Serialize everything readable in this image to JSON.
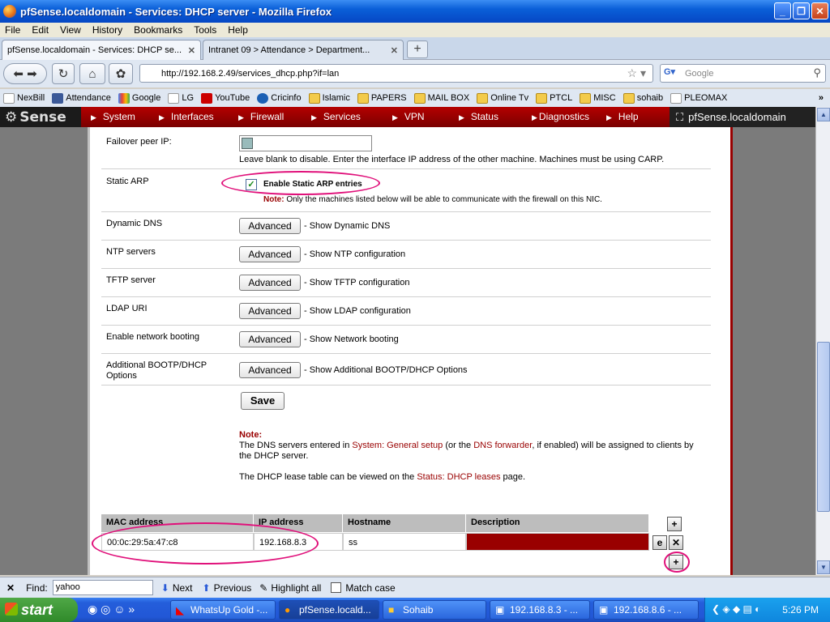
{
  "window": {
    "title": "pfSense.localdomain - Services: DHCP server - Mozilla Firefox"
  },
  "menu": [
    "File",
    "Edit",
    "View",
    "History",
    "Bookmarks",
    "Tools",
    "Help"
  ],
  "tabs": [
    {
      "label": "pfSense.localdomain - Services: DHCP se...",
      "active": true
    },
    {
      "label": "Intranet 09 > Attendance > Department...",
      "active": false
    }
  ],
  "nav": {
    "url": "http://192.168.2.49/services_dhcp.php?if=lan",
    "search_placeholder": "Google"
  },
  "bookmarks": [
    "NexBill",
    "Attendance",
    "Google",
    "LG",
    "YouTube",
    "Cricinfo",
    "Islamic",
    "PAPERS",
    "MAIL BOX",
    "Online Tv",
    "PTCL",
    "MISC",
    "sohaib",
    "PLEOMAX"
  ],
  "pfsense": {
    "logo": "Sense",
    "menu": [
      "System",
      "Interfaces",
      "Firewall",
      "Services",
      "VPN",
      "Status",
      "Diagnostics",
      "Help"
    ],
    "hostname": "pfSense.localdomain"
  },
  "form": {
    "failover": {
      "label": "Failover peer IP:",
      "help": "Leave blank to disable. Enter the interface IP address of the other machine. Machines must be using CARP."
    },
    "static_arp": {
      "label": "Static ARP",
      "checkbox_label": "Enable Static ARP entries",
      "checked": true,
      "note_label": "Note:",
      "note": "Only the machines listed below will be able to communicate with the firewall on this NIC."
    },
    "advanced_label": "Advanced",
    "advanced_rows": [
      {
        "label": "Dynamic DNS",
        "desc": "- Show Dynamic DNS"
      },
      {
        "label": "NTP servers",
        "desc": "- Show NTP configuration"
      },
      {
        "label": "TFTP server",
        "desc": "- Show TFTP configuration"
      },
      {
        "label": "LDAP URI",
        "desc": "- Show LDAP configuration"
      },
      {
        "label": "Enable network booting",
        "desc": "- Show Network booting"
      },
      {
        "label": "Additional BOOTP/DHCP Options",
        "desc": "- Show Additional BOOTP/DHCP Options"
      }
    ],
    "save_label": "Save",
    "note_title": "Note:",
    "note_p1_a": "The DNS servers entered in ",
    "note_p1_link1": "System: General setup",
    "note_p1_b": " (or the ",
    "note_p1_link2": "DNS forwarder",
    "note_p1_c": ", if enabled) will be assigned to clients by the DHCP server.",
    "note_p2_a": "The DHCP lease table can be viewed on the ",
    "note_p2_link": "Status: DHCP leases",
    "note_p2_b": " page."
  },
  "table": {
    "headers": [
      "MAC address",
      "IP address",
      "Hostname",
      "Description"
    ],
    "rows": [
      {
        "mac": "00:0c:29:5a:47:c8",
        "ip": "192.168.8.3",
        "hostname": "ss",
        "description": ""
      }
    ]
  },
  "findbar": {
    "label": "Find:",
    "value": "yahoo",
    "next": "Next",
    "previous": "Previous",
    "highlight": "Highlight all",
    "match_case": "Match case"
  },
  "taskbar": {
    "start": "start",
    "items": [
      "WhatsUp Gold -...",
      "pfSense.locald...",
      "Sohaib",
      "192.168.8.3 - ...",
      "192.168.8.6 - ..."
    ],
    "clock": "5:26 PM"
  },
  "colors": {
    "pf_red": "#990000",
    "annotation": "#e0107a",
    "desc_cell": "#990000"
  }
}
